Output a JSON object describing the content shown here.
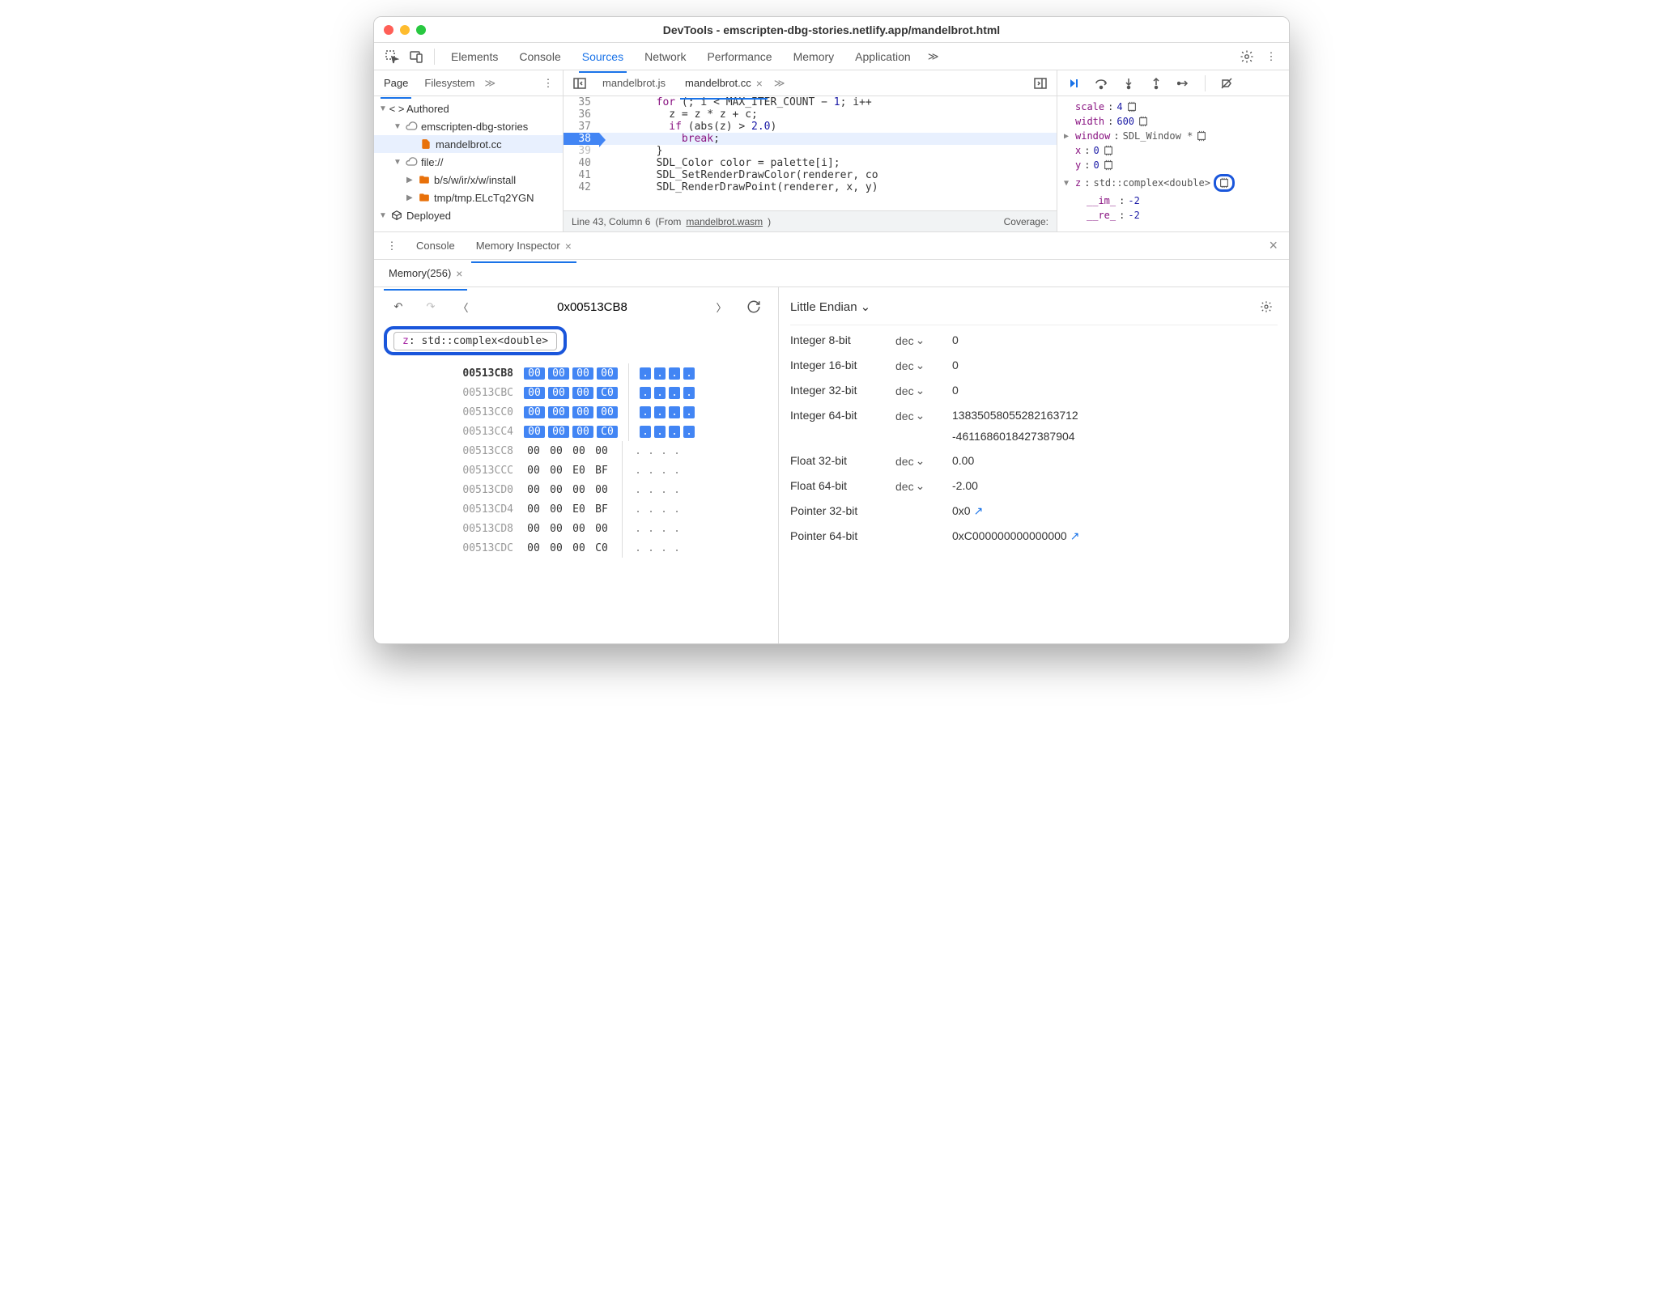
{
  "window": {
    "title": "DevTools - emscripten-dbg-stories.netlify.app/mandelbrot.html"
  },
  "mainTabs": [
    "Elements",
    "Console",
    "Sources",
    "Network",
    "Performance",
    "Memory",
    "Application"
  ],
  "mainTabsActive": "Sources",
  "sidebar": {
    "tabs": [
      "Page",
      "Filesystem"
    ],
    "activeTab": "Page",
    "tree": {
      "authored": "Authored",
      "domain": "emscripten-dbg-stories",
      "file": "mandelbrot.cc",
      "fileScheme": "file://",
      "path1": "b/s/w/ir/x/w/install",
      "path2": "tmp/tmp.ELcTq2YGN",
      "deployed": "Deployed"
    }
  },
  "codeTabs": {
    "tab1": "mandelbrot.js",
    "tab2": "mandelbrot.cc"
  },
  "code": {
    "l35": {
      "ln": "35",
      "t1": "for",
      "t2": " (; i < MAX_ITER_COUNT − ",
      "t3": "1",
      "t4": "; i++"
    },
    "l36": {
      "ln": "36",
      "t1": "  z = z * z + c;"
    },
    "l37": {
      "ln": "37",
      "t1": "if",
      "t2": " (abs(z) > ",
      "t3": "2.0",
      "t4": ")"
    },
    "l38": {
      "ln": "38",
      "t1": "break",
      "t2": ";"
    },
    "l39": {
      "ln": "39",
      "t1": "}"
    },
    "l40": {
      "ln": "40",
      "t1": "SDL_Color",
      "t2": " color = palette[i];"
    },
    "l41": {
      "ln": "41",
      "t1": "SDL_SetRenderDrawColor(renderer, co"
    },
    "l42": {
      "ln": "42",
      "t1": "SDL_RenderDrawPoint(renderer, x, y)"
    }
  },
  "status": {
    "pos": "Line 43, Column 6",
    "from": "(From ",
    "link": "mandelbrot.wasm",
    "cov": "Coverage:"
  },
  "scope": {
    "scale": {
      "name": "scale",
      "val": "4"
    },
    "width": {
      "name": "width",
      "val": "600"
    },
    "window": {
      "name": "window",
      "type": "SDL_Window *"
    },
    "x": {
      "name": "x",
      "val": "0"
    },
    "y": {
      "name": "y",
      "val": "0"
    },
    "z": {
      "name": "z",
      "type": "std::complex<double>"
    },
    "im": {
      "name": "__im_",
      "val": "-2"
    },
    "re": {
      "name": "__re_",
      "val": "-2"
    }
  },
  "drawer": {
    "console": "Console",
    "memInspector": "Memory Inspector"
  },
  "memTab": {
    "label": "Memory(256)"
  },
  "memNav": {
    "address": "0x00513CB8"
  },
  "chip": {
    "z": "z",
    "rest": ": std::complex<double>"
  },
  "hexRows": [
    {
      "addr": "00513CB8",
      "bold": true,
      "hex": [
        "00",
        "00",
        "00",
        "00"
      ],
      "hl": true,
      "asc": [
        ".",
        ".",
        ".",
        "."
      ]
    },
    {
      "addr": "00513CBC",
      "bold": false,
      "hex": [
        "00",
        "00",
        "00",
        "C0"
      ],
      "hl": true,
      "asc": [
        ".",
        ".",
        ".",
        "."
      ]
    },
    {
      "addr": "00513CC0",
      "bold": false,
      "hex": [
        "00",
        "00",
        "00",
        "00"
      ],
      "hl": true,
      "asc": [
        ".",
        ".",
        ".",
        "."
      ]
    },
    {
      "addr": "00513CC4",
      "bold": false,
      "hex": [
        "00",
        "00",
        "00",
        "C0"
      ],
      "hl": true,
      "asc": [
        ".",
        ".",
        ".",
        "."
      ]
    },
    {
      "addr": "00513CC8",
      "bold": false,
      "hex": [
        "00",
        "00",
        "00",
        "00"
      ],
      "hl": false,
      "asc": [
        ".",
        ".",
        ".",
        "."
      ]
    },
    {
      "addr": "00513CCC",
      "bold": false,
      "hex": [
        "00",
        "00",
        "E0",
        "BF"
      ],
      "hl": false,
      "asc": [
        ".",
        ".",
        ".",
        "."
      ]
    },
    {
      "addr": "00513CD0",
      "bold": false,
      "hex": [
        "00",
        "00",
        "00",
        "00"
      ],
      "hl": false,
      "asc": [
        ".",
        ".",
        ".",
        "."
      ]
    },
    {
      "addr": "00513CD4",
      "bold": false,
      "hex": [
        "00",
        "00",
        "E0",
        "BF"
      ],
      "hl": false,
      "asc": [
        ".",
        ".",
        ".",
        "."
      ]
    },
    {
      "addr": "00513CD8",
      "bold": false,
      "hex": [
        "00",
        "00",
        "00",
        "00"
      ],
      "hl": false,
      "asc": [
        ".",
        ".",
        ".",
        "."
      ]
    },
    {
      "addr": "00513CDC",
      "bold": false,
      "hex": [
        "00",
        "00",
        "00",
        "C0"
      ],
      "hl": false,
      "asc": [
        ".",
        ".",
        ".",
        "."
      ]
    }
  ],
  "endian": "Little Endian",
  "values": {
    "i8": {
      "label": "Integer 8-bit",
      "fmt": "dec",
      "val": "0"
    },
    "i16": {
      "label": "Integer 16-bit",
      "fmt": "dec",
      "val": "0"
    },
    "i32": {
      "label": "Integer 32-bit",
      "fmt": "dec",
      "val": "0"
    },
    "i64": {
      "label": "Integer 64-bit",
      "fmt": "dec",
      "val1": "13835058055282163712",
      "val2": "-4611686018427387904"
    },
    "f32": {
      "label": "Float 32-bit",
      "fmt": "dec",
      "val": "0.00"
    },
    "f64": {
      "label": "Float 64-bit",
      "fmt": "dec",
      "val": "-2.00"
    },
    "p32": {
      "label": "Pointer 32-bit",
      "val": "0x0"
    },
    "p64": {
      "label": "Pointer 64-bit",
      "val": "0xC000000000000000"
    }
  }
}
